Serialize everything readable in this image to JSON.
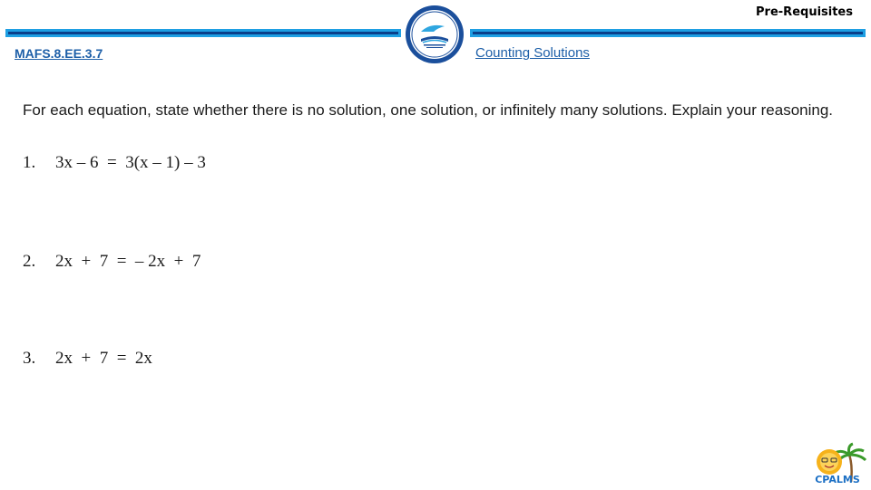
{
  "header": {
    "section_title": "Pre-Requisites",
    "standard_code": "MAFS.8.EE.3.7",
    "lesson_title": "Counting Solutions",
    "logo": "school-district-seal-icon"
  },
  "content": {
    "instructions": "For each equation, state whether there is no solution, one solution, or infinitely many solutions. Explain your reasoning.",
    "problems": [
      {
        "number": "1.",
        "equation": "3x – 6  =  3(x – 1) – 3"
      },
      {
        "number": "2.",
        "equation": "2x  +  7  =  – 2x  +  7"
      },
      {
        "number": "3.",
        "equation": "2x  +  7  =  2x"
      }
    ]
  },
  "footer": {
    "mascot": "cpalms-sun-palm-logo-icon",
    "mascot_text": "CPALMS"
  },
  "colors": {
    "accent_light": "#1e9fe3",
    "accent_dark": "#0a3f8a",
    "link": "#1d5fa8"
  }
}
